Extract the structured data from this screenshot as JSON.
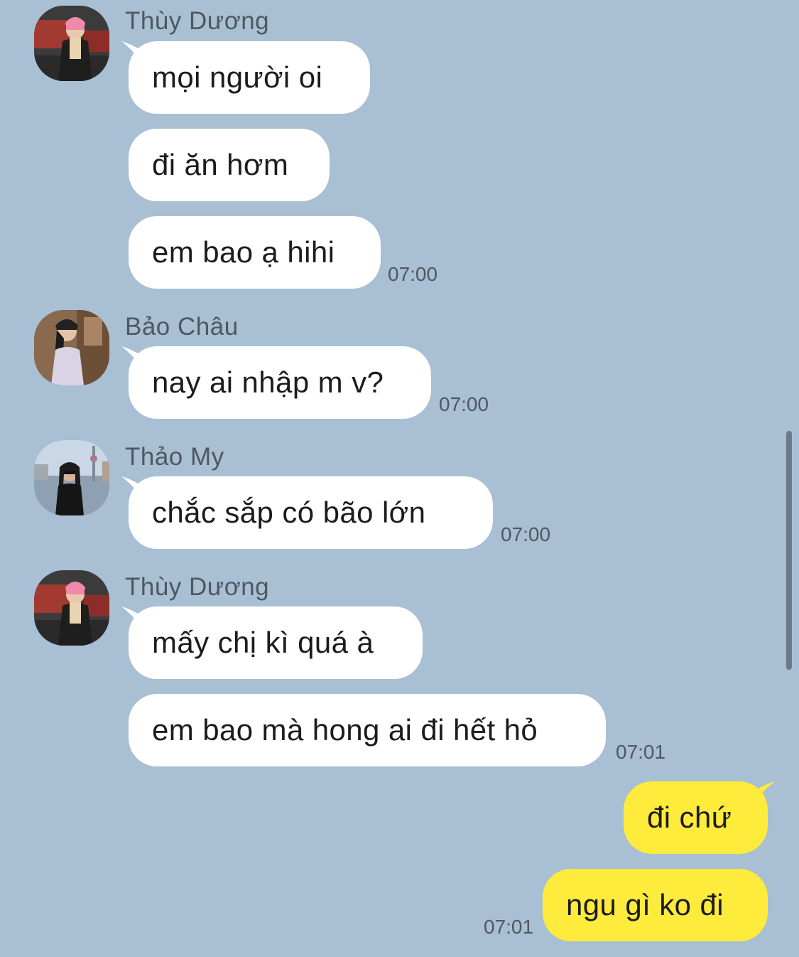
{
  "groups": [
    {
      "sender": "Thùy Dương",
      "avatar_icon": "user-avatar-thuy-duong",
      "messages": [
        "mọi người oi",
        "đi ăn hơm",
        "em bao ạ hihi"
      ],
      "time": "07:00"
    },
    {
      "sender": "Bảo Châu",
      "avatar_icon": "user-avatar-bao-chau",
      "messages": [
        "nay ai nhập m v?"
      ],
      "time": "07:00"
    },
    {
      "sender": "Thảo My",
      "avatar_icon": "user-avatar-thao-my",
      "messages": [
        "chắc sắp có bão lớn"
      ],
      "time": "07:00"
    },
    {
      "sender": "Thùy Dương",
      "avatar_icon": "user-avatar-thuy-duong",
      "messages": [
        "mấy chị kì quá à",
        "em bao mà hong ai đi hết hỏ"
      ],
      "time": "07:01"
    }
  ],
  "my_messages": {
    "messages": [
      "đi chứ",
      "ngu gì ko đi"
    ],
    "time": "07:01"
  },
  "colors": {
    "background": "#a9bfd3",
    "incoming_bubble": "#ffffff",
    "outgoing_bubble": "#ffeb3b",
    "meta_text": "#4f5862"
  }
}
